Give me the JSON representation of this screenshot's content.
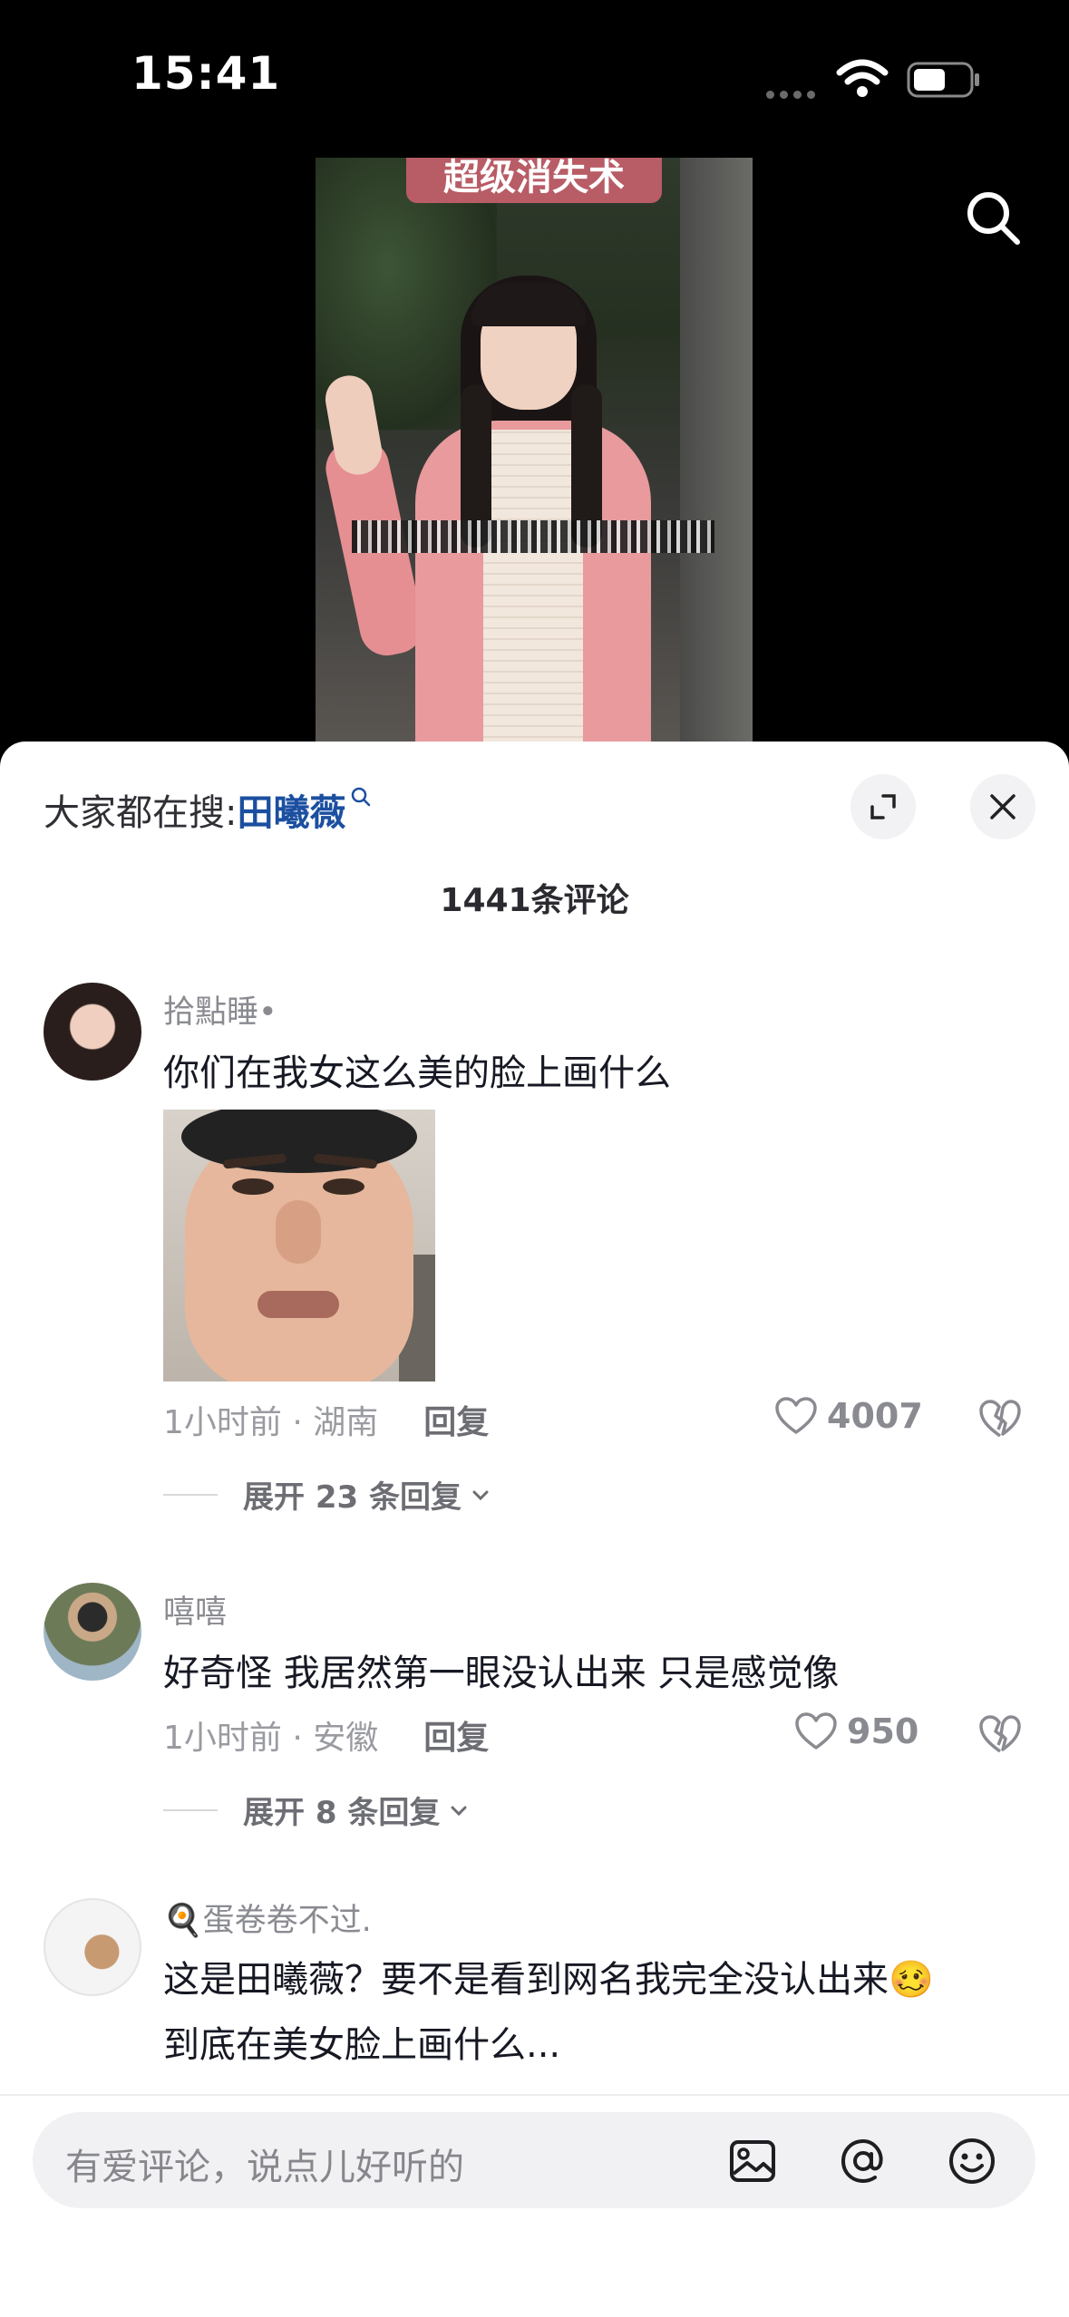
{
  "status_bar": {
    "time": "15:41"
  },
  "video": {
    "caption": "超级消失术"
  },
  "panel": {
    "trending_label": "大家都在搜:",
    "trending_keyword": "田曦薇",
    "comment_count": "1441条评论"
  },
  "comments": [
    {
      "username": "拾點睡•",
      "text": "你们在我女这么美的脸上画什么",
      "meta": "1小时前 · 湖南",
      "reply_label": "回复",
      "likes": "4007",
      "expand_label": "展开 23 条回复"
    },
    {
      "username": "嘻嘻",
      "text": "好奇怪 我居然第一眼没认出来 只是感觉像",
      "meta": "1小时前 · 安徽",
      "reply_label": "回复",
      "likes": "950",
      "expand_label": "展开 8 条回复"
    },
    {
      "username": "🍳蛋卷卷不过.",
      "text_line1": "这是田曦薇？要不是看到网名我完全没认出来🥴",
      "text_line2": "到底在美女脸上画什么..."
    }
  ],
  "input": {
    "placeholder": "有爱评论，说点儿好听的"
  },
  "icons": {
    "wifi": "wifi-icon",
    "battery": "battery-icon",
    "search": "search-icon",
    "expand": "expand-icon",
    "close": "close-icon",
    "heart": "heart-icon",
    "broken_heart": "broken-heart-icon",
    "chevron": "chevron-down-icon",
    "image": "image-icon",
    "mention": "at-icon",
    "emoji": "emoji-icon"
  }
}
